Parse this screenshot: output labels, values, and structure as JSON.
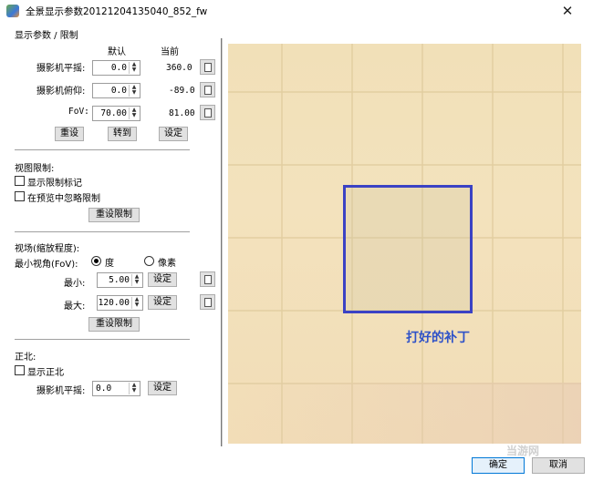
{
  "window": {
    "title": "全景显示参数20121204135040_852_fw",
    "close_glyph": "✕"
  },
  "params": {
    "group_title": "显示参数 / 限制",
    "header_default": "默认",
    "header_current": "当前",
    "rows": [
      {
        "label": "摄影机平摇:",
        "value": "0.0",
        "current": "360.0"
      },
      {
        "label": "摄影机俯仰:",
        "value": "0.0",
        "current": "-89.0"
      },
      {
        "label": "FoV:",
        "value": "70.00",
        "current": "81.00"
      }
    ],
    "btn_reset": "重设",
    "btn_goto": "转到",
    "btn_set": "设定"
  },
  "view_limit": {
    "title": "视图限制:",
    "show_limit_marks": "显示限制标记",
    "ignore_in_preview": "在预览中忽略限制",
    "btn_reset_limit": "重设限制"
  },
  "fov_limit": {
    "title": "视场(缩放程度):",
    "min_label": "最小视角(FoV):",
    "unit_degree": "度",
    "unit_pixel": "像素",
    "min": {
      "label": "最小:",
      "value": "5.00",
      "btn": "设定"
    },
    "max": {
      "label": "最大:",
      "value": "120.00",
      "btn": "设定"
    },
    "btn_reset_limit": "重设限制"
  },
  "north": {
    "title": "正北:",
    "show_north": "显示正北",
    "pan_label": "摄影机平摇:",
    "pan_value": "0.0",
    "btn_set": "设定"
  },
  "preview": {
    "annotation": "打好的补丁",
    "box_color": "#3b42c4",
    "annotation_color": "#2f52c8"
  },
  "footer": {
    "ok": "确定",
    "cancel": "取消"
  },
  "watermark": "当游网"
}
